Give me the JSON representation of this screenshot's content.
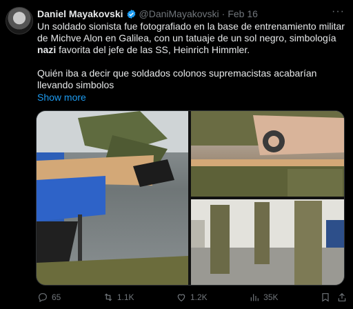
{
  "author": {
    "name": "Daniel Mayakovski",
    "handle": "@DaniMayakovski",
    "separator": "·",
    "date": "Feb 16"
  },
  "tweet": {
    "line1": "Un soldado sionista fue fotografiado en la base de entrenamiento militar de Michve Alon en Galilea, con un tatuaje de un sol negro, simbología ",
    "bold_word": "nazi",
    "line2": " favorita del jefe de las SS, Heinrich Himmler.",
    "paragraph2": "Quién iba a decir que soldados colonos supremacistas acabarían llevando simbolos",
    "show_more": "Show more"
  },
  "actions": {
    "replies": "65",
    "reposts": "1.1K",
    "likes": "1.2K",
    "views": "35K"
  },
  "colors": {
    "background": "#000000",
    "text": "#e7e9ea",
    "secondary": "#71767b",
    "link": "#1d9bf0",
    "verified": "#1d9bf0"
  },
  "icons": [
    "verified-badge-icon",
    "more-options-icon",
    "reply-icon",
    "repost-icon",
    "like-icon",
    "views-icon",
    "bookmark-icon",
    "share-icon"
  ]
}
